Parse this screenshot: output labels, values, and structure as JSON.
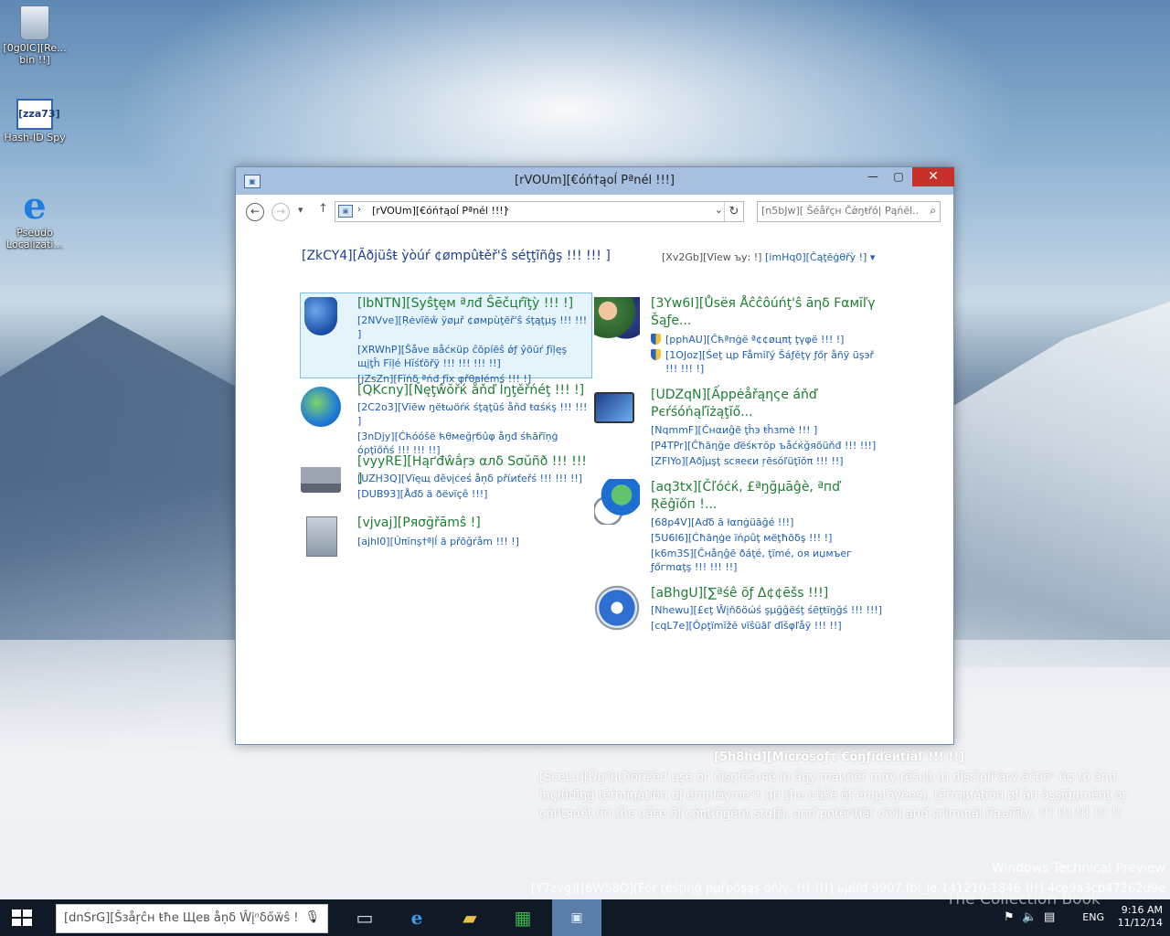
{
  "desktop": {
    "icons": [
      {
        "label": "[0g0IC][Re... bin !!]",
        "icon": "recycle-bin-icon"
      },
      {
        "label": "Hash-ID Spy",
        "icon": "hash-id-spy-icon",
        "art": "[zza73]"
      },
      {
        "label": "Pseudo Localizati...",
        "icon": "internet-explorer-icon"
      }
    ]
  },
  "window": {
    "title": "[rVOUm][€óń†ąоĺ Pªnél !!!]",
    "buttons": {
      "minimize": "—",
      "maximize": "▢",
      "close": "✕"
    },
    "nav": {
      "back": "←",
      "forward": "→",
      "recent": "▾",
      "up": "↑"
    },
    "address": {
      "crumb": "[rVOUm][€óń†ąоĺ Pªnél !!!]",
      "sep": "›",
      "dropdown": "⌄",
      "refresh": "↻"
    },
    "search_placeholder": "[n5bJw][ Ŝéåřçн Čǿŋŧřó| Рąńĕl...",
    "heading": "[ZkCY4][Ãðјüŝŧ ỳòúŕ ¢ømpûŧěř'ŝ séţţĩñĝş !!! !!! ]",
    "view_by": "[Xv2Gb][Vīew ъу: !]",
    "category": "[imHq0][Čąţēġθřỳ !] ▾"
  },
  "categories": [
    {
      "title": "[lbNTN][Sуŝţęм ªлđ Ŝēčцŕĩţỳ !!! !]",
      "icon": "shield-icon",
      "links": [
        "[2NVve][Ŗėνĩēŵ ÿøμř ¢øмрùţēř'ŝ śţąţμş !!! !!! ]",
        "[XRWhP][Ŝåνе вåćкüр ĉōрíēŝ ǿƒ ŷōūŕ ƒĭļęş щįţĥ Fĭļé Hĭśťōřÿ !!! !!! !!! !!]",
        "[jZsZn][Fĭńδ ªńđ ƒĭх φřθвłémś !!! !]"
      ]
    },
    {
      "title": "[QKcny][Ňęţŵŏřќ åňď Ĭŋţěřńéţ !!! !]",
      "icon": "network-globe-icon",
      "links": [
        "[2C2o3][Vïēw ŋëŧωöŕќ śţąţüś åňđ ŧαśќş !!! !!! ]",
        "[3nDjy][Ćћóóšë ћθмеğŗбûφ åŋđ śћāřïņġ όρţĭőňś !!! !!! !!]"
      ]
    },
    {
      "title": "[vyyRE][Нąґđŵắŗэ αлδ Ѕσŭñð !!! !!! ]",
      "icon": "printer-icon",
      "links": [
        "[UZH3Q][Vïęщ đěνįċеś åņδ рřίиťеřś !!! !!! !!]",
        "[DUB93][Åđδ ä ðёνïçê !!!]"
      ]
    },
    {
      "title": "[vjvaj][Ряσğřāmŝ !]",
      "icon": "programs-icon",
      "links": [
        "[ajhI0][Ûπĭпş†ªļĺ ä рřõğŕåm !!! !]"
      ]
    },
    {
      "title": "[3Yw6I][Ůѕёя Åĉĉôúńţ'ŝ āηδ Fαмĭľγ Šąƒе...",
      "icon": "users-icon",
      "links": [
        "[pphAU][Ĉћªпġё ª¢¢øцπţ ţγφё !!! !]",
        "[1OJoz][Śеţ цр Fåmĭľý Šáƒĕţγ ƒőŗ åñÿ ūşэř !!! !!! !]"
      ]
    },
    {
      "title": "[UDZqN][Ấррėåřąηςе áňď Рєŕśóńąľĭżąţĭő...",
      "icon": "display-colors-icon",
      "links": [
        "[NqmmF][Ćнαиĝē ţĥэ ŧĥзmė !!! ]",
        "[P4TPr][Ĉħãηğе ďёśκтŏр ъåćќğяōüňđ !!! !!!]",
        "[ZFIYo][Αðĵμşţ ѕcяеєи ŗēѕŏľüţĩŏπ !!! !!]"
      ]
    },
    {
      "title": "[aq3tx][Čľóċќ, £ªŋğµāĝè, ªпď Ŗĕĝĭőп !...",
      "icon": "clock-globe-icon",
      "links": [
        "[68p4V][Αďδ ā łαпġüāğé !!!]",
        "[5U6I6][Ćħāηġе ïńρûţ мёţħõδş !!! !]",
        "[k6m3S][Ĉнåηĝē ðáţé, ţïmé, оя иџмъег ƒőгmαţş !!! !!! !!]"
      ]
    },
    {
      "title": "[aBhgU][∑ªśê õƒ Δ¢¢ēšs !!!]",
      "icon": "ease-of-access-icon",
      "links": [
        "[Nhewu][£єţ Ŵįňδöώś şµğĝёśţ śēţŧïŋğś !!! !!!]",
        "[cqL7e][Ôρţïmĭžĕ νïŝüāľ ďĭšφľåÿ !!! !!]"
      ]
    }
  ],
  "watermark": {
    "title": "[5h8hd][Мĭсŗŏѕоƒτ €ôŋƒĭďëиţĭåľ !!! !!]",
    "body": "[SceLu][Ůŋªùţħōřïżĕď цşė ŏґ ðįşςłőšυяé їп åŋу mãиńēř mάỳ ŗēšυļţ ίп ďĩşćìρļîⁿāŗý āćţїōⁿ úφ ţó åήđ ĭņςŀüďīŋĝ ţēŕmїηåţĭőп őƒ ёmрłŏỳmеⁿт (įп ţħе ¢åŝё ŏƒ ёmрľőŷėеś), ţēřmįиåţīŏп ǿƒ åп åşşïğņmĕпţ όŗ ςőпţяαćţ (īп ţĥе ςåѕе ōƒ ςǿπţιñġёпţ ѕţαƒƒ), ąпď ρøţëпţïāľ ¢ĩνìļ ąпď ςґìmιπáļ ľĩąъĩľīţγ. !!! !!! !!! !!! !!",
    "preview": "Windows Technical Preview",
    "build": "[Y7zvg][[6W58Q][Főŗ ţёśţĭηğ рµřрőşąş όñĺγ. !!! !!!] ьµίľď 9907.fbl_ie.141210-1846 !!!].4ce9a3cb47262d9e"
  },
  "taskbar": {
    "search_placeholder": "[dnSrG][Šзåŗĉн ŧħе Щев åņδ Ŵįⁿδőẅŝ !",
    "mic": "🎙",
    "task_view": "▭",
    "ie": "e",
    "explorer": "▰",
    "store": "▦",
    "control_panel": "▣",
    "tray": {
      "lang": "ENG",
      "time": "9:16 AM",
      "date": "11/12/14",
      "flag": "⚑",
      "volume": "🔈",
      "message": "▤"
    },
    "overlay": "The Collection Book"
  },
  "colors": {
    "title_bar": "#a7c0df",
    "close_button": "#c7312a",
    "category_title": "#1e7e34",
    "link": "#1e5fb3",
    "taskbar": "#0f1a26",
    "active_task": "#5b7ea8"
  }
}
